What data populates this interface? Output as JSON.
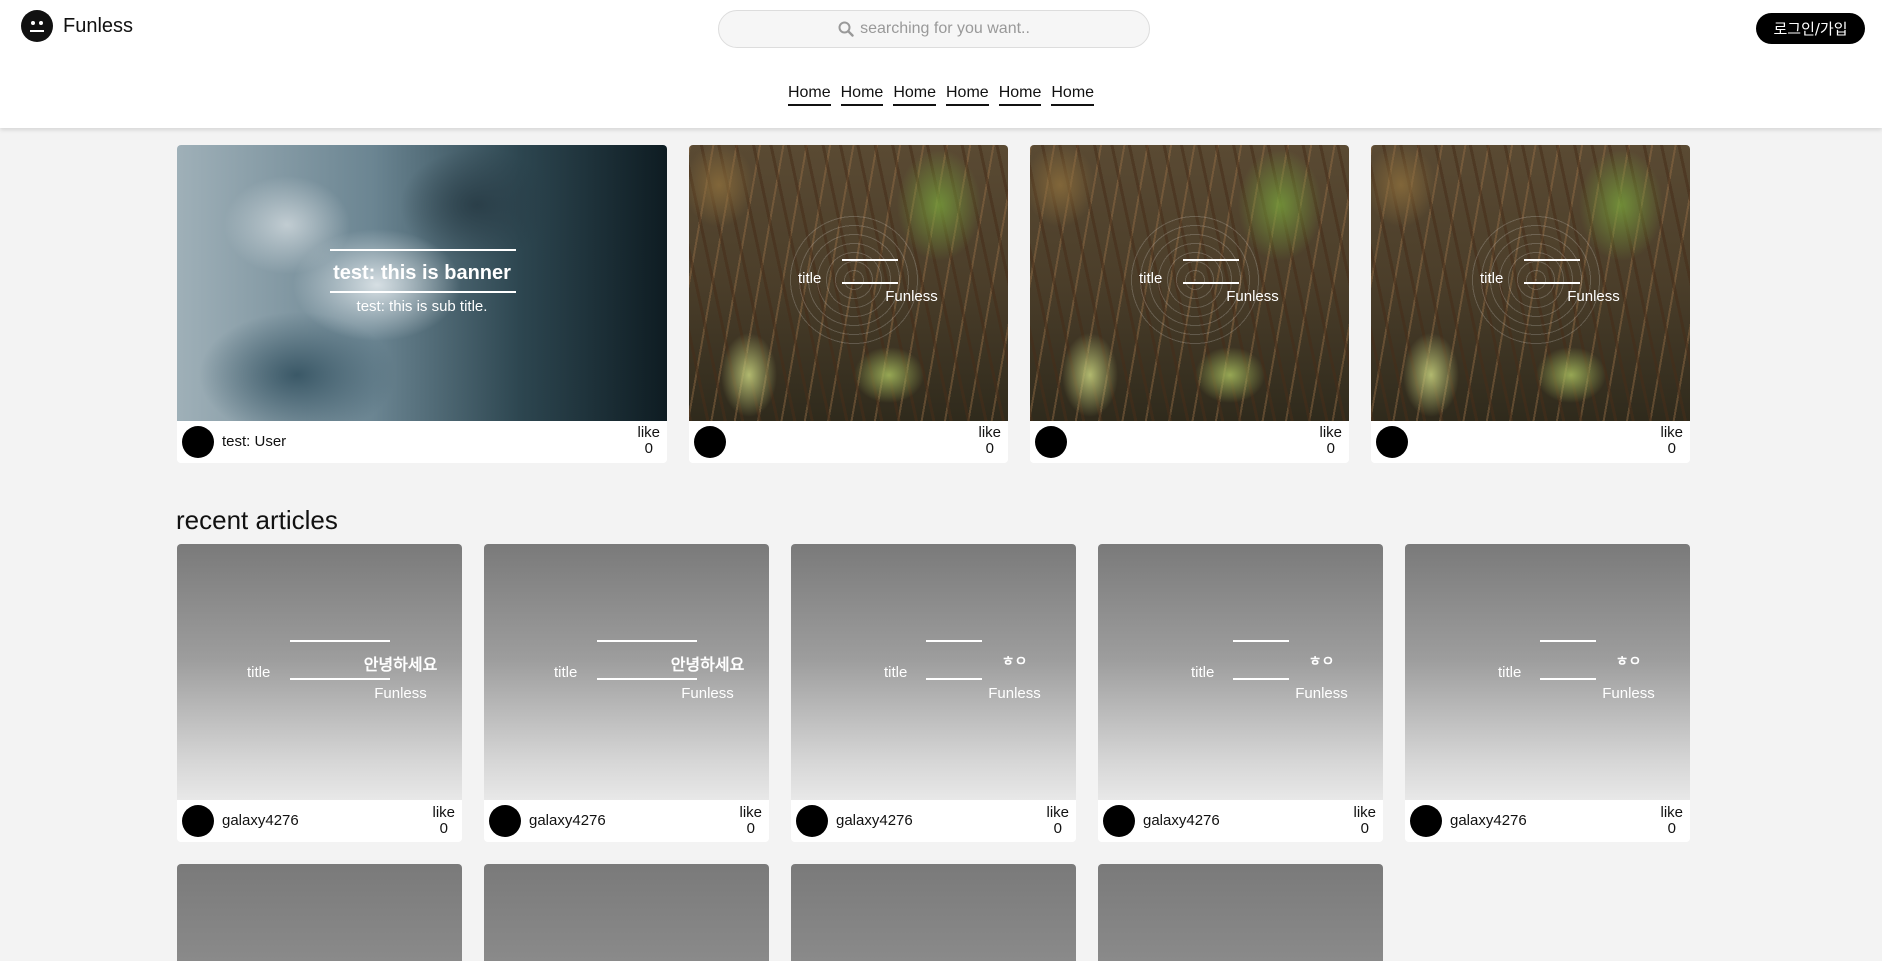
{
  "header": {
    "brand": "Funless",
    "search_placeholder": "searching for you want..",
    "login_label": "로그인/가입",
    "nav": [
      "Home",
      "Home",
      "Home",
      "Home",
      "Home",
      "Home"
    ]
  },
  "featured": {
    "banner": {
      "title": "test: this is banner",
      "subtitle": "test: this is sub title.",
      "author": "test: User",
      "like_label": "like",
      "like_count": "0"
    },
    "cards": [
      {
        "img_alt": "title",
        "subtitle": "Funless",
        "like_label": "like",
        "like_count": "0"
      },
      {
        "img_alt": "title",
        "subtitle": "Funless",
        "like_label": "like",
        "like_count": "0"
      },
      {
        "img_alt": "title",
        "subtitle": "Funless",
        "like_label": "like",
        "like_count": "0"
      }
    ]
  },
  "recent": {
    "heading": "recent articles",
    "articles": [
      {
        "img_alt": "title",
        "title": "안녕하세요",
        "subtitle": "Funless",
        "author": "galaxy4276",
        "like_label": "like",
        "like_count": "0"
      },
      {
        "img_alt": "title",
        "title": "안녕하세요",
        "subtitle": "Funless",
        "author": "galaxy4276",
        "like_label": "like",
        "like_count": "0"
      },
      {
        "img_alt": "title",
        "title": "ㅎㅇ",
        "subtitle": "Funless",
        "author": "galaxy4276",
        "like_label": "like",
        "like_count": "0"
      },
      {
        "img_alt": "title",
        "title": "ㅎㅇ",
        "subtitle": "Funless",
        "author": "galaxy4276",
        "like_label": "like",
        "like_count": "0"
      },
      {
        "img_alt": "title",
        "title": "ㅎㅇ",
        "subtitle": "Funless",
        "author": "galaxy4276",
        "like_label": "like",
        "like_count": "0"
      }
    ]
  },
  "colors": {
    "background": "#f3f3f3",
    "header_bg": "#ffffff",
    "button_bg": "#000000",
    "button_text": "#ffffff"
  }
}
